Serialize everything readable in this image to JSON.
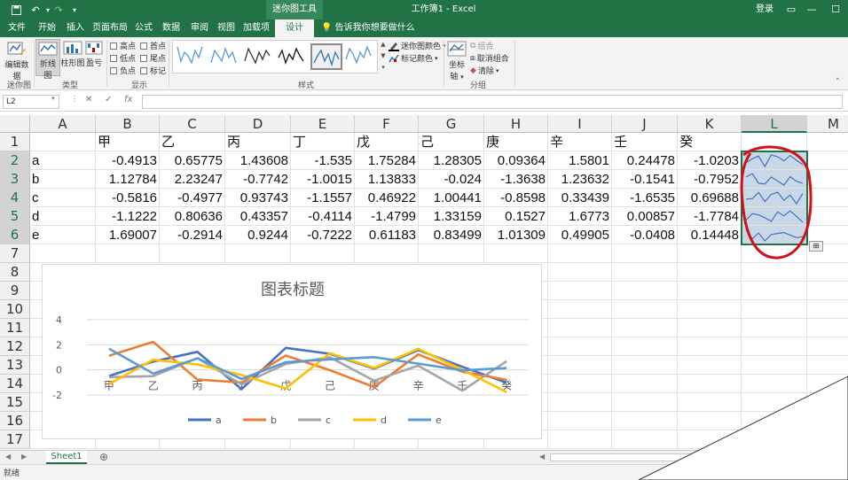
{
  "title_bar": {
    "context_tab": "迷你图工具",
    "document_title": "工作簿1 - Excel",
    "login": "登录"
  },
  "tabs": [
    {
      "label": "文件"
    },
    {
      "label": "开始"
    },
    {
      "label": "插入"
    },
    {
      "label": "页面布局"
    },
    {
      "label": "公式"
    },
    {
      "label": "数据"
    },
    {
      "label": "审阅"
    },
    {
      "label": "视图"
    },
    {
      "label": "加载项"
    },
    {
      "label": "设计",
      "active": true
    }
  ],
  "tell_me": "告诉我你想要做什么",
  "ribbon": {
    "edit_data": "编辑数据",
    "group_sparkline": "迷你图",
    "type_line": "折线图",
    "type_column": "柱形图",
    "type_winloss": "盈亏",
    "group_type": "类型",
    "show_options": [
      "高点",
      "首点",
      "低点",
      "尾点",
      "负点",
      "标记"
    ],
    "group_show": "显示",
    "group_style": "样式",
    "sparkline_color": "迷你图颜色",
    "marker_color": "标记颜色",
    "axis": "坐标轴",
    "group_action": "组合",
    "ungroup": "取消组合",
    "clear": "清除",
    "group_group": "分组"
  },
  "formula_bar": {
    "name_box": "L2",
    "fx": "fx",
    "value": ""
  },
  "grid": {
    "columns": [
      "A",
      "B",
      "C",
      "D",
      "E",
      "F",
      "G",
      "H",
      "I",
      "J",
      "K",
      "L",
      "M"
    ],
    "selected_column": "L",
    "rows": [
      "1",
      "2",
      "3",
      "4",
      "5",
      "6",
      "7",
      "8",
      "9",
      "10",
      "11",
      "12",
      "13",
      "14",
      "15",
      "16",
      "17"
    ],
    "headers": [
      "甲",
      "乙",
      "丙",
      "丁",
      "戊",
      "己",
      "庚",
      "辛",
      "壬",
      "癸"
    ],
    "row_labels": [
      "a",
      "b",
      "c",
      "d",
      "e"
    ],
    "display_values": [
      [
        "-0.4913",
        "0.65775",
        "1.43608",
        "-1.535",
        "1.75284",
        "1.28305",
        "0.09364",
        "1.5801",
        "0.24478",
        "-1.0203"
      ],
      [
        "1.12784",
        "2.23247",
        "-0.7742",
        "-1.0015",
        "1.13833",
        "-0.024",
        "-1.3638",
        "1.23632",
        "-0.1541",
        "-0.7952"
      ],
      [
        "-0.5816",
        "-0.4977",
        "0.93743",
        "-1.1557",
        "0.46922",
        "1.00441",
        "-0.8598",
        "0.33439",
        "-1.6535",
        "0.69688"
      ],
      [
        "-1.1222",
        "0.80636",
        "0.43357",
        "-0.4114",
        "-1.4799",
        "1.33159",
        "0.1527",
        "1.6773",
        "0.00857",
        "-1.7784"
      ],
      [
        "1.69007",
        "-0.2914",
        "0.9244",
        "-0.7222",
        "0.61183",
        "0.83499",
        "1.01309",
        "0.49905",
        "-0.0408",
        "0.14448"
      ]
    ]
  },
  "chart_data": {
    "type": "line",
    "title": "图表标题",
    "categories": [
      "甲",
      "乙",
      "丙",
      "丁",
      "戊",
      "己",
      "庚",
      "辛",
      "壬",
      "癸"
    ],
    "ylim": [
      -2,
      4
    ],
    "yticks": [
      -2,
      0,
      2,
      4
    ],
    "grid": true,
    "legend_position": "bottom",
    "series": [
      {
        "name": "a",
        "color": "#4472c4",
        "values": [
          -0.4913,
          0.65775,
          1.43608,
          -1.535,
          1.75284,
          1.28305,
          0.09364,
          1.5801,
          0.24478,
          -1.0203
        ]
      },
      {
        "name": "b",
        "color": "#ed7d31",
        "values": [
          1.12784,
          2.23247,
          -0.7742,
          -1.0015,
          1.13833,
          -0.024,
          -1.3638,
          1.23632,
          -0.1541,
          -0.7952
        ]
      },
      {
        "name": "c",
        "color": "#a5a5a5",
        "values": [
          -0.5816,
          -0.4977,
          0.93743,
          -1.1557,
          0.46922,
          1.00441,
          -0.8598,
          0.33439,
          -1.6535,
          0.69688
        ]
      },
      {
        "name": "d",
        "color": "#ffc000",
        "values": [
          -1.1222,
          0.80636,
          0.43357,
          -0.4114,
          -1.4799,
          1.33159,
          0.1527,
          1.6773,
          0.00857,
          -1.7784
        ]
      },
      {
        "name": "e",
        "color": "#5b9bd5",
        "values": [
          1.69007,
          -0.2914,
          0.9244,
          -0.7222,
          0.61183,
          0.83499,
          1.01309,
          0.49905,
          -0.0408,
          0.14448
        ]
      }
    ]
  },
  "sparkline_color": "#4472c4",
  "sheet_tab": "Sheet1",
  "status": "就绪"
}
